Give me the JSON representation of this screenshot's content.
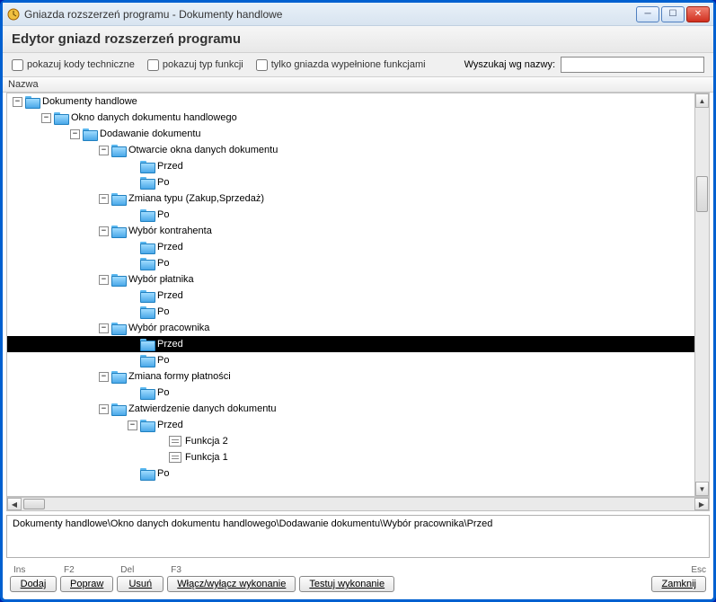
{
  "window": {
    "title": "Gniazda rozszerzeń programu - Dokumenty handlowe"
  },
  "subtitle": "Edytor gniazd rozszerzeń programu",
  "filters": {
    "show_tech_codes": "pokazuj kody techniczne",
    "show_func_type": "pokazuj typ funkcji",
    "only_filled": "tylko gniazda wypełnione funkcjami",
    "search_label": "Wyszukaj wg nazwy:"
  },
  "columns": {
    "name": "Nazwa"
  },
  "tree": {
    "n0": "Dokumenty handlowe",
    "n1": "Okno danych dokumentu handlowego",
    "n2": "Dodawanie dokumentu",
    "n3": "Otwarcie okna danych dokumentu",
    "n3a": "Przed",
    "n3b": "Po",
    "n4": "Zmiana typu (Zakup,Sprzedaż)",
    "n4b": "Po",
    "n5": "Wybór kontrahenta",
    "n5a": "Przed",
    "n5b": "Po",
    "n6": "Wybór płatnika",
    "n6a": "Przed",
    "n6b": "Po",
    "n7": "Wybór pracownika",
    "n7a": "Przed",
    "n7b": "Po",
    "n8": "Zmiana formy płatności",
    "n8b": "Po",
    "n9": "Zatwierdzenie danych dokumentu",
    "n9a": "Przed",
    "n9a1": "Funkcja 2",
    "n9a2": "Funkcja 1",
    "n9b": "Po"
  },
  "path": "Dokumenty handlowe\\Okno danych dokumentu handlowego\\Dodawanie dokumentu\\Wybór pracownika\\Przed",
  "buttons": {
    "ins": "Ins",
    "add": "Dodaj",
    "f2": "F2",
    "edit": "Popraw",
    "del": "Del",
    "remove": "Usuń",
    "f3": "F3",
    "toggle": "Włącz/wyłącz wykonanie",
    "test": "Testuj wykonanie",
    "esc": "Esc",
    "close": "Zamknij"
  }
}
